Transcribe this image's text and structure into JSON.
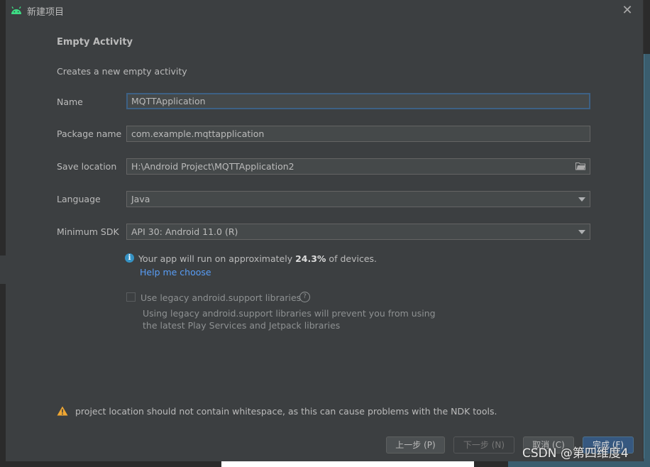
{
  "window": {
    "title": "新建项目"
  },
  "form": {
    "heading": "Empty Activity",
    "subheading": "Creates a new empty activity",
    "name": {
      "label": "Name",
      "value": "MQTTApplication"
    },
    "package": {
      "label": "Package name",
      "value": "com.example.mqttapplication"
    },
    "save_location": {
      "label": "Save location",
      "value": "H:\\Android Project\\MQTTApplication2"
    },
    "language": {
      "label": "Language",
      "value": "Java"
    },
    "min_sdk": {
      "label": "Minimum SDK",
      "value": "API 30: Android 11.0 (R)"
    }
  },
  "info": {
    "prefix": "Your app will run on approximately ",
    "percent": "24.3%",
    "suffix": " of devices.",
    "help_link": "Help me choose"
  },
  "legacy": {
    "label": "Use legacy android.support libraries",
    "checked": false,
    "description": "Using legacy android.support libraries will prevent you from using the latest Play Services and Jetpack libraries"
  },
  "warning": "project location should not contain whitespace, as this can cause problems with the NDK tools.",
  "buttons": {
    "previous": "上一步 (P)",
    "next": "下一步 (N)",
    "cancel": "取消 (C)",
    "finish": "完成 (F)"
  },
  "watermark": "CSDN @第四维度4",
  "colors": {
    "dialog_bg": "#3c3f41",
    "field_bg": "#45494a",
    "focus_border": "#3d6185",
    "link": "#589df6",
    "android_green": "#3ddc84",
    "warning_yellow": "#f0a732",
    "primary_button": "#365880"
  }
}
